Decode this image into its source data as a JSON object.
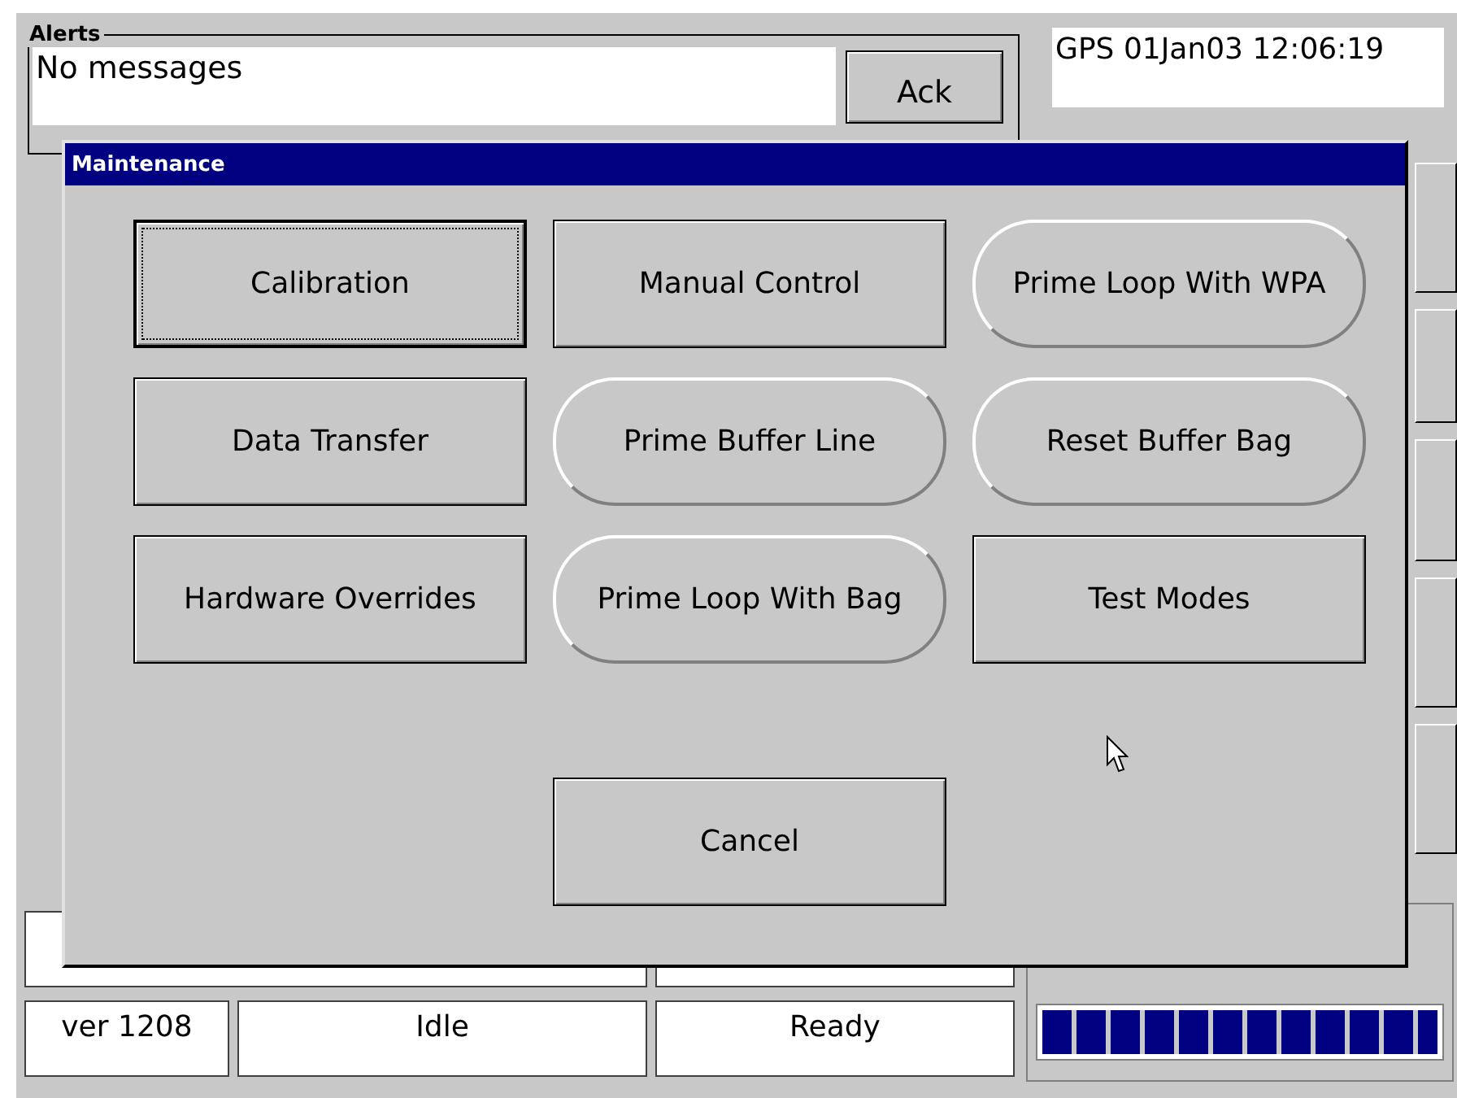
{
  "alerts": {
    "title": "Alerts",
    "message": "No messages",
    "ack_button": "Ack"
  },
  "gps": "GPS 01Jan03 12:06:19",
  "status": {
    "version": "ver 1208",
    "state": "Idle",
    "readiness": "Ready",
    "level": 1
  },
  "dialog": {
    "title": "Maintenance",
    "buttons": [
      {
        "label": "Calibration",
        "kind": "rect",
        "focused": true
      },
      {
        "label": "Manual Control",
        "kind": "rect",
        "focused": false
      },
      {
        "label": "Prime Loop With WPA",
        "kind": "pill",
        "focused": false
      },
      {
        "label": "Data Transfer",
        "kind": "rect",
        "focused": false
      },
      {
        "label": "Prime Buffer Line",
        "kind": "pill",
        "focused": false
      },
      {
        "label": "Reset Buffer Bag",
        "kind": "pill",
        "focused": false
      },
      {
        "label": "Hardware Overrides",
        "kind": "rect",
        "focused": false
      },
      {
        "label": "Prime Loop With Bag",
        "kind": "pill",
        "focused": false
      },
      {
        "label": "Test Modes",
        "kind": "rect",
        "focused": false
      }
    ],
    "cancel_button": "Cancel"
  }
}
